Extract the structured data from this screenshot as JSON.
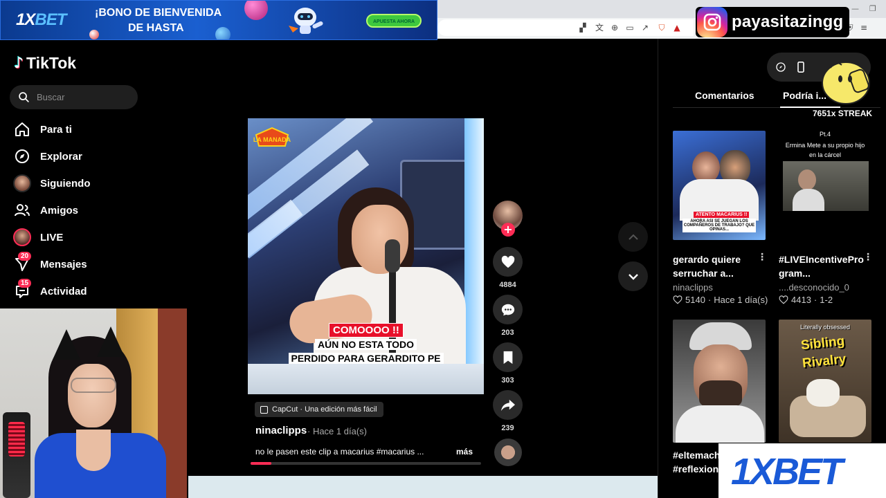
{
  "banner": {
    "logo_a": "1X",
    "logo_b": "BET",
    "line1": "¡BONO DE BIENVENIDA",
    "line2": "DE HASTA",
    "cta": "APUESTA AHORA"
  },
  "sidebar": {
    "app_name": "TikTok",
    "search_placeholder": "Buscar",
    "items": [
      {
        "label": "Para ti",
        "icon": "home-icon"
      },
      {
        "label": "Explorar",
        "icon": "compass-icon"
      },
      {
        "label": "Siguiendo",
        "icon": "avatar"
      },
      {
        "label": "Amigos",
        "icon": "friends-icon"
      },
      {
        "label": "LIVE",
        "icon": "avatar"
      },
      {
        "label": "Mensajes",
        "icon": "send-icon",
        "badge": "20"
      },
      {
        "label": "Actividad",
        "icon": "inbox-icon",
        "badge": "15"
      }
    ]
  },
  "video": {
    "channel_logo": "LA MANADA",
    "caption_red": "COMOOOO !!",
    "caption_line2": "AÚN NO ESTA TODO",
    "caption_line3": "PERDIDO PARA GERARDITO PE",
    "capcut_label": "CapCut · Una edición más fácil",
    "author": "ninaclipps",
    "time": "· Hace 1 día(s)",
    "description": "no le pasen este clip a macarius #macarius ...",
    "more": "más",
    "progress": 0.09
  },
  "actions": {
    "likes": "4884",
    "comments": "203",
    "saves": "303",
    "shares": "239"
  },
  "right_panel": {
    "tabs": [
      "Comentarios",
      "Podría i..."
    ],
    "cards": [
      {
        "title": "gerardo quiere serruchar a...",
        "author": "ninaclipps",
        "likes": "5140",
        "meta": "Hace 1 día(s)",
        "thumb_text_1": "ATENTO MACARIUS !!",
        "thumb_text_2": "AHORA ASI SE JUEGAN LOS COMPAÑEROS DE TRABAJO? QUE OPINAS..."
      },
      {
        "title": "#LIVEIncentivePro gram...",
        "author": "....desconocido_0",
        "likes": "4413",
        "meta": "1-2",
        "thumb_text_1": "Pt.4",
        "thumb_text_2": "Ermina Mete a su propio hijo en la cárcel"
      },
      {
        "title": "#eltemach",
        "title2": "#reflexion"
      },
      {
        "title": "",
        "thumb_text_1": "Literally obsessed",
        "thumb_text_2": "Sibling",
        "thumb_text_3": "Rivalry"
      }
    ]
  },
  "overlays": {
    "instagram_handle": "payasitazingg",
    "streak": "7651x STREAK",
    "ad_word": "1XBET"
  }
}
